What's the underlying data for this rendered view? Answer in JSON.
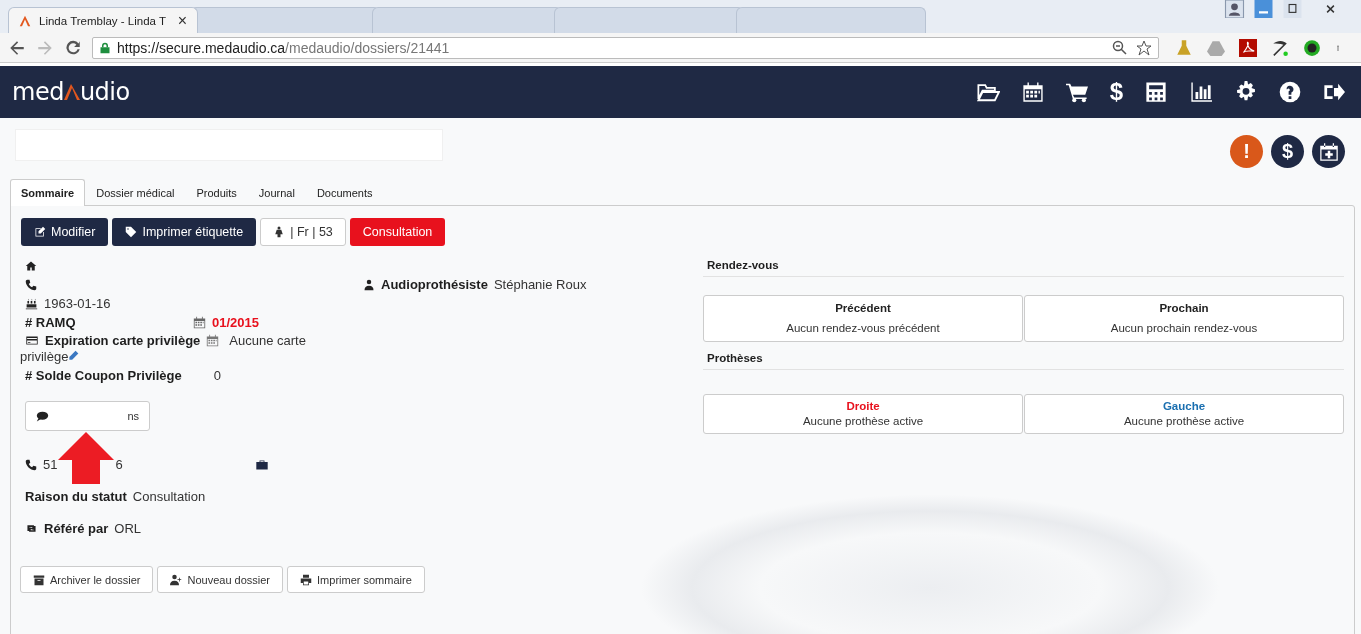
{
  "browser": {
    "tabs": [
      {
        "title": "Linda Tremblay - Linda T",
        "selected": true
      },
      {
        "selected": false
      },
      {
        "selected": false
      },
      {
        "selected": false
      },
      {
        "selected": false
      }
    ],
    "close": "×",
    "url": {
      "host": "https://secure.medaudio.ca",
      "path": "/medaudio/dossiers/21441"
    }
  },
  "app": {
    "logo": [
      "med",
      "udio"
    ],
    "nav_money": "$"
  },
  "header": {
    "alert": "!",
    "money": "$"
  },
  "tabs": [
    {
      "label": "Sommaire",
      "selected": true
    },
    {
      "label": "Dossier médical",
      "selected": false
    },
    {
      "label": "Produits",
      "selected": false
    },
    {
      "label": "Journal",
      "selected": false
    },
    {
      "label": "Documents",
      "selected": false
    }
  ],
  "actions": [
    {
      "kind": "dark",
      "label": "Modifier"
    },
    {
      "kind": "dark",
      "label": "Imprimer étiquette"
    },
    {
      "kind": "outline",
      "label": "| Fr | 53"
    },
    {
      "kind": "red",
      "label": "Consultation"
    }
  ],
  "summary": {
    "birth_date": "1963-01-16",
    "audiologist_label": "Audioprothésiste",
    "audiologist": "Stéphanie Roux",
    "ramq_label": "# RAMQ",
    "ramq_expiry": "01/2015",
    "card_label": "Expiration carte privilège",
    "card_value_lines": [
      "Aucune carte",
      "privilège"
    ],
    "coupon_label": "# Solde Coupon Privilège",
    "coupon_value": "0",
    "notes_button": "ns",
    "phone_start": "51",
    "phone_end": "6",
    "status_label": "Raison du statut",
    "status_value": "Consultation",
    "referred_label": "Référé par",
    "referred_value": "ORL"
  },
  "footer_buttons": [
    {
      "label": "Archiver le dossier"
    },
    {
      "label": "Nouveau dossier"
    },
    {
      "label": "Imprimer sommaire"
    }
  ],
  "appointments": {
    "title": "Rendez-vous",
    "cards": [
      {
        "title": "Précédent",
        "text": "Aucun rendez-vous précédent"
      },
      {
        "title": "Prochain",
        "text": "Aucun prochain rendez-vous"
      }
    ]
  },
  "prostheses": {
    "title": "Prothèses",
    "cards": [
      {
        "title": "Droite",
        "text": "Aucune prothèse active",
        "color": "#e8111d"
      },
      {
        "title": "Gauche",
        "text": "Aucune prothèse active",
        "color": "#1a6fb0"
      }
    ]
  }
}
